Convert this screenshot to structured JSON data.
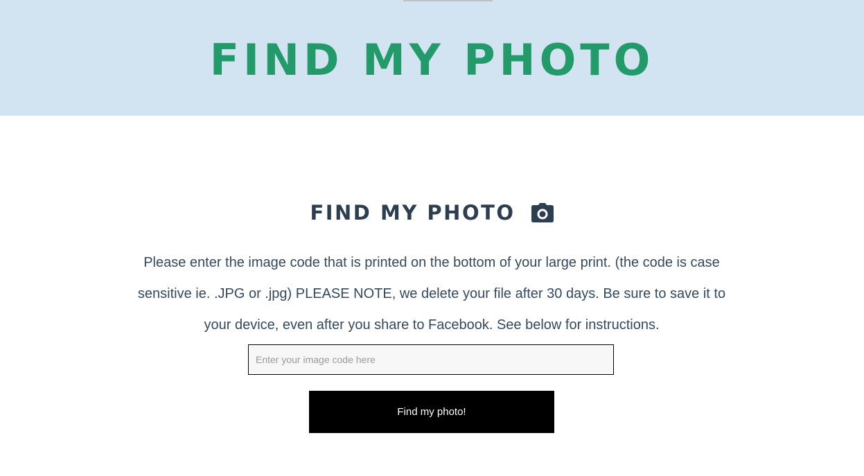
{
  "hero": {
    "title": "FIND MY PHOTO",
    "title_color": "#239a69",
    "background_color": "#d2e4f1"
  },
  "main": {
    "heading": "FIND MY PHOTO",
    "heading_icon": "camera-icon",
    "instructions": "Please enter the image code that is printed on the bottom of your large print. (the code is case sensitive ie. .JPG or .jpg) PLEASE NOTE, we delete your file after 30 days. Be sure to save it to your device, even after you share to Facebook. See below for instructions.",
    "code_input": {
      "placeholder": "Enter your image code here",
      "value": ""
    },
    "submit_label": "Find my photo!"
  }
}
